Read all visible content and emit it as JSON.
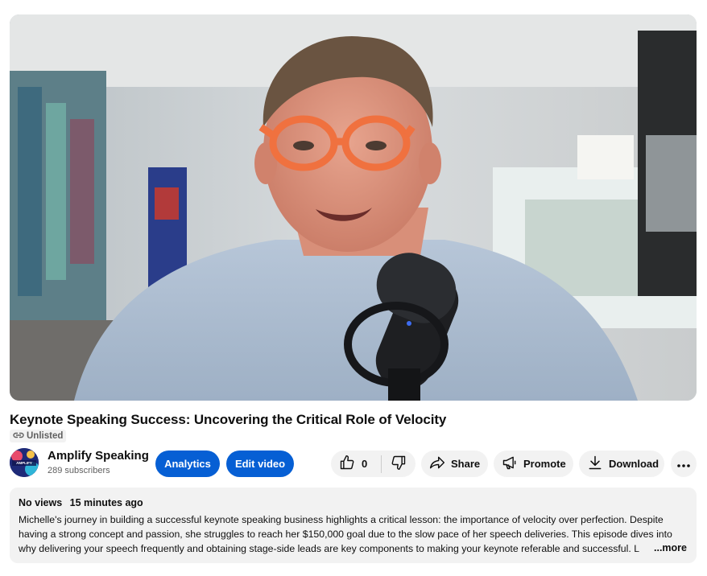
{
  "video": {
    "title": "Keynote Speaking Success: Uncovering the Critical Role of Velocity",
    "visibility": "Unlisted"
  },
  "channel": {
    "name": "Amplify Speaking",
    "subscribers": "289 subscribers",
    "avatar_text": "AMPLIFY"
  },
  "actions": {
    "analytics_label": "Analytics",
    "edit_label": "Edit video",
    "like_count": "0",
    "share_label": "Share",
    "promote_label": "Promote",
    "download_label": "Download"
  },
  "description": {
    "views": "No views",
    "time": "15 minutes ago",
    "text": "Michelle's journey in building a successful keynote speaking business highlights a critical lesson: the importance of velocity over perfection. Despite having a strong concept and passion, she struggles to reach her $150,000 goal due to the slow pace of her speech deliveries. This episode dives into why delivering your speech frequently and obtaining stage-side leads are key components to making your keynote referable and successful. L",
    "more_label": "...more"
  },
  "icons": {
    "visibility": "link-icon",
    "like": "thumbs-up-icon",
    "dislike": "thumbs-down-icon",
    "share": "share-arrow-icon",
    "promote": "megaphone-icon",
    "download": "download-icon",
    "more": "more-horizontal-icon"
  },
  "colors": {
    "primary_button": "#065fd4",
    "chip_background": "#f2f2f2",
    "text_primary": "#0f0f0f",
    "text_secondary": "#606060"
  }
}
